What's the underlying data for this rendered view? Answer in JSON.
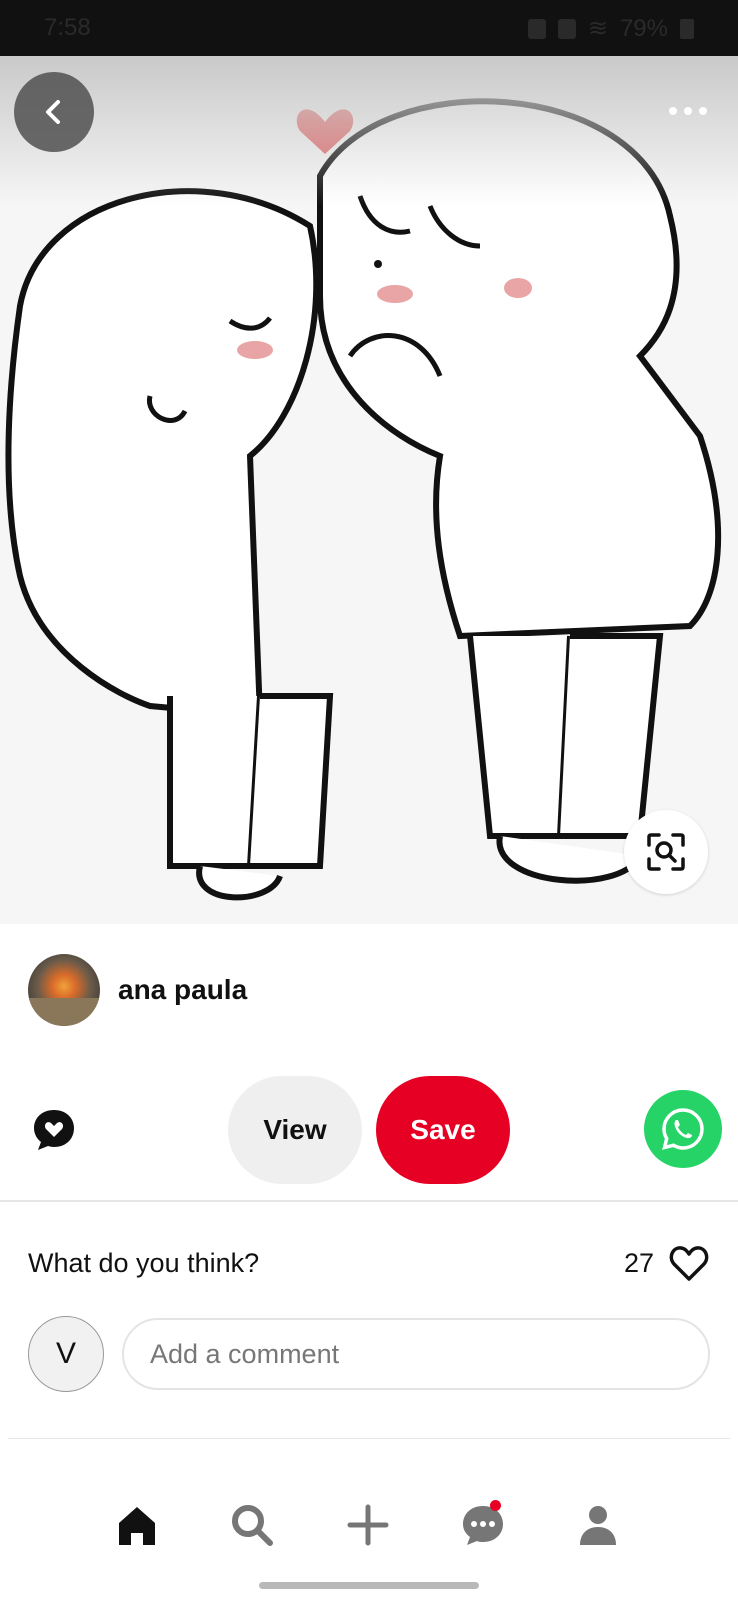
{
  "status_bar": {
    "time": "7:58",
    "battery": "79%"
  },
  "pin": {
    "image_description": "Cartoon couple illustration with heart"
  },
  "author": {
    "name": "ana paula"
  },
  "actions": {
    "view_label": "View",
    "save_label": "Save"
  },
  "comments": {
    "title": "What do you think?",
    "likes_count": "27",
    "user_initial": "V",
    "input_placeholder": "Add a comment"
  },
  "bottom_nav": {
    "items": [
      "home",
      "search",
      "create",
      "messages",
      "profile"
    ],
    "messages_has_notification": true
  },
  "colors": {
    "save": "#e60023",
    "share": "#25d366",
    "view_bg": "#efefef"
  }
}
